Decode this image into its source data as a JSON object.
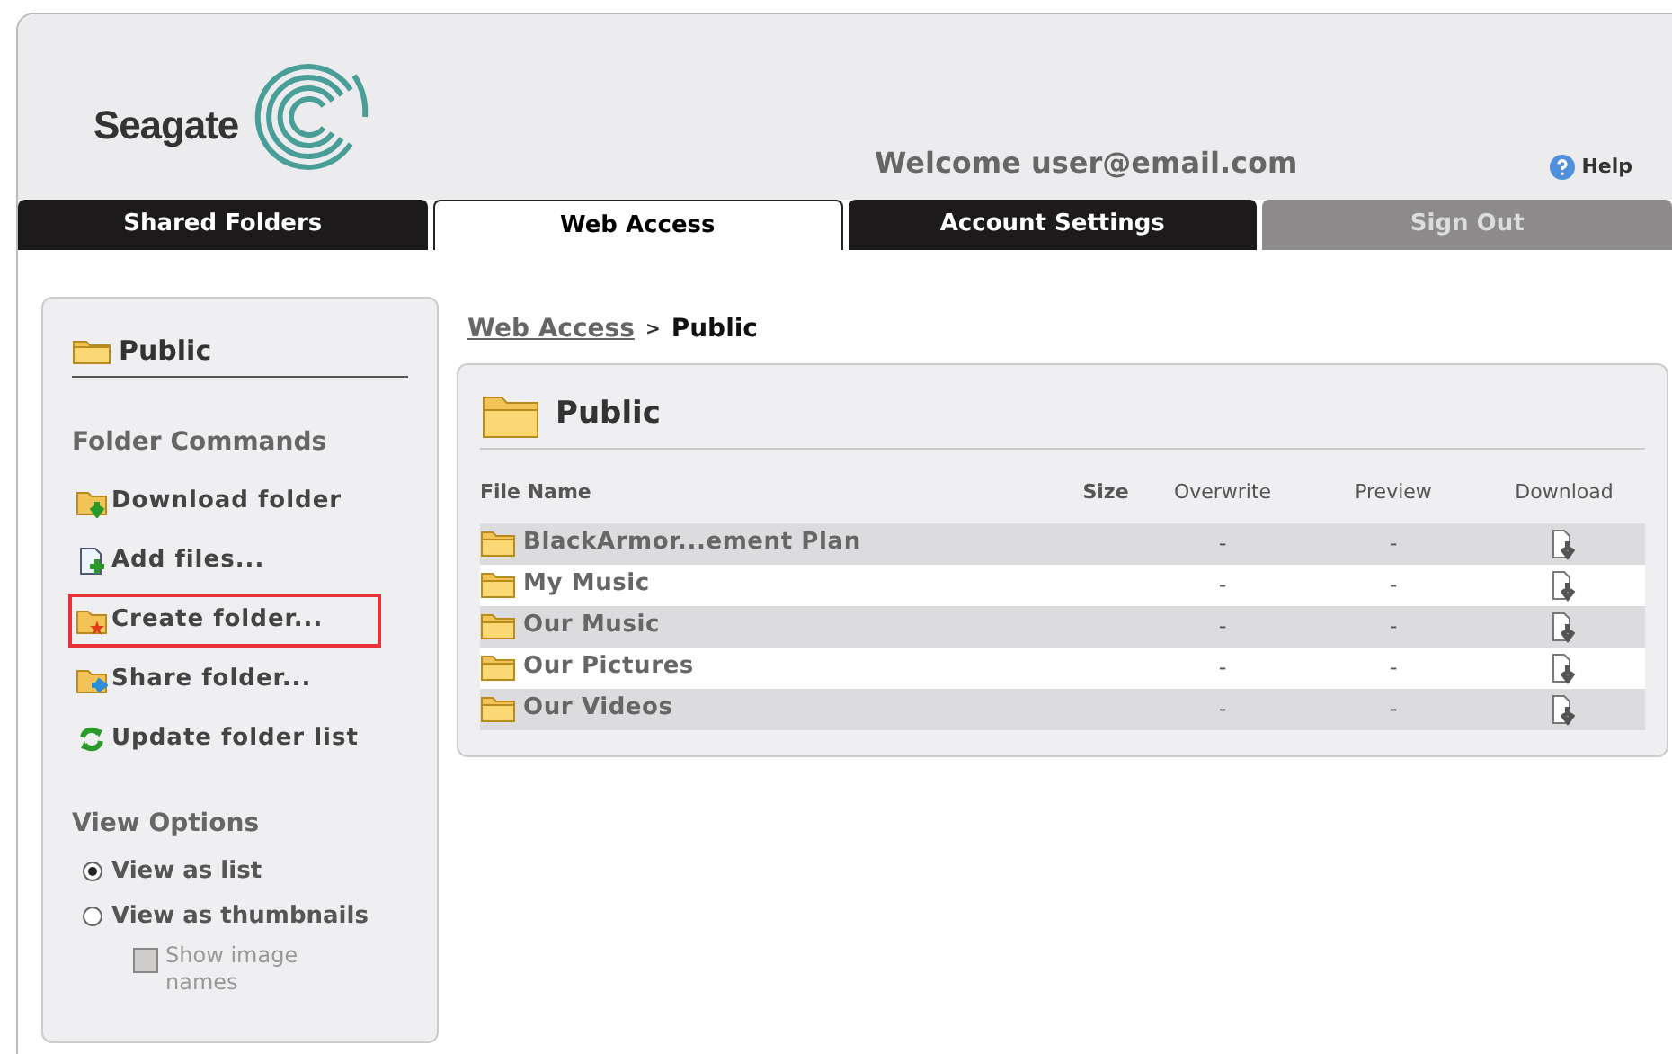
{
  "header": {
    "brand": "Seagate",
    "welcome": "Welcome user@email.com",
    "help": "Help"
  },
  "tabs": [
    {
      "label": "Shared Folders",
      "selected": false,
      "disabled": false
    },
    {
      "label": "Web Access",
      "selected": true,
      "disabled": false
    },
    {
      "label": "Account Settings",
      "selected": false,
      "disabled": false
    },
    {
      "label": "Sign Out",
      "selected": false,
      "disabled": true
    }
  ],
  "sidebar": {
    "folder": "Public",
    "commands_title": "Folder Commands",
    "commands": [
      {
        "kind": "download",
        "label": "Download folder",
        "highlighted": false
      },
      {
        "kind": "add",
        "label": "Add files...",
        "highlighted": false
      },
      {
        "kind": "create",
        "label": "Create folder...",
        "highlighted": true
      },
      {
        "kind": "share",
        "label": "Share folder...",
        "highlighted": false
      },
      {
        "kind": "refresh",
        "label": "Update folder list",
        "highlighted": false
      }
    ],
    "view_title": "View Options",
    "view_options": [
      {
        "label": "View as list",
        "selected": true
      },
      {
        "label": "View as thumbnails",
        "selected": false
      }
    ],
    "show_names": {
      "label": "Show image names",
      "checked": false,
      "disabled": true
    }
  },
  "breadcrumb": {
    "link": "Web Access",
    "separator": ">",
    "current": "Public"
  },
  "panel": {
    "title": "Public",
    "columns": [
      "File Name",
      "Size",
      "Overwrite",
      "Preview",
      "Download"
    ],
    "rows": [
      {
        "name": "BlackArmor...ement Plan",
        "overwrite": "-",
        "preview": "-"
      },
      {
        "name": "My Music",
        "overwrite": "-",
        "preview": "-"
      },
      {
        "name": "Our Music",
        "overwrite": "-",
        "preview": "-"
      },
      {
        "name": "Our Pictures",
        "overwrite": "-",
        "preview": "-"
      },
      {
        "name": "Our Videos",
        "overwrite": "-",
        "preview": "-"
      }
    ]
  }
}
